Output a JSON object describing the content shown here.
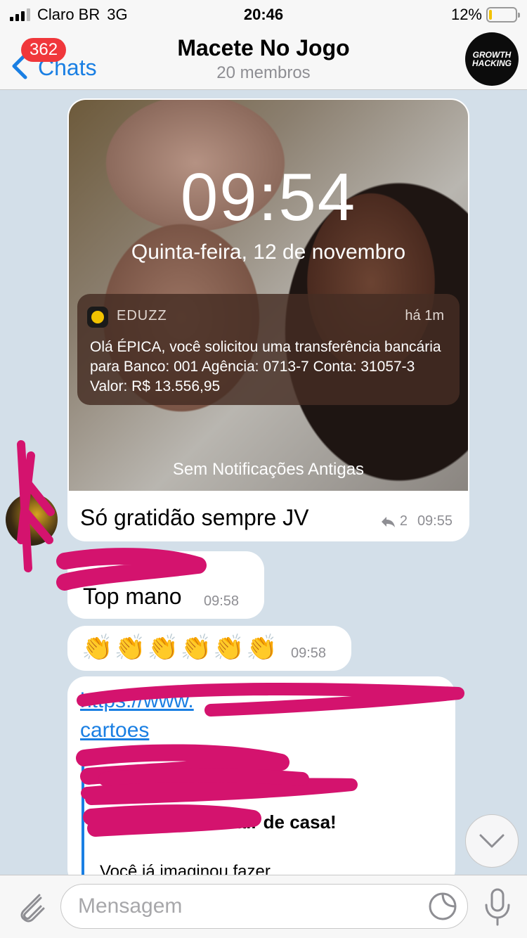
{
  "status_bar": {
    "carrier": "Claro BR",
    "network": "3G",
    "time": "20:46",
    "battery": "12%",
    "battery_level": 0.12
  },
  "nav": {
    "back_label": "Chats",
    "unread_badge": "362",
    "title": "Macete No Jogo",
    "subtitle": "20 membros",
    "avatar_text_1": "GROWTH",
    "avatar_text_2": "HACKING"
  },
  "messages": {
    "photo": {
      "lock_time": "09:54",
      "lock_date": "Quinta-feira, 12 de novembro",
      "notification": {
        "app": "EDUZZ",
        "when": "há 1m",
        "body": "Olá ÉPICA, você solicitou uma transferência bancária para Banco: 001 Agência: 0713-7 Conta: 31057-3 Valor: R$ 13.556,95"
      },
      "footer": "Sem Notificações Antigas",
      "caption": "Só gratidão sempre JV",
      "replies": "2",
      "time": "09:55"
    },
    "text1": {
      "text": "Top mano",
      "time": "09:58"
    },
    "text2": {
      "text": "👏👏👏👏👏👏",
      "time": "09:58"
    },
    "link": {
      "url_start": "https://www.",
      "url_end": "cartoes",
      "preview_title": ". Compre sem sair de casa!",
      "preview_desc": "Você já imaginou fazer"
    }
  },
  "input": {
    "placeholder": "Mensagem"
  },
  "colors": {
    "accent": "#1a7fe3",
    "badge": "#f0373b",
    "scribble": "#d4136e",
    "chat_bg": "#d3dfe9"
  },
  "icons": [
    "back-chevron-icon",
    "attach-paperclip-icon",
    "sticker-icon",
    "microphone-icon",
    "chevron-down-icon",
    "reply-icon",
    "eduzz-app-icon"
  ]
}
